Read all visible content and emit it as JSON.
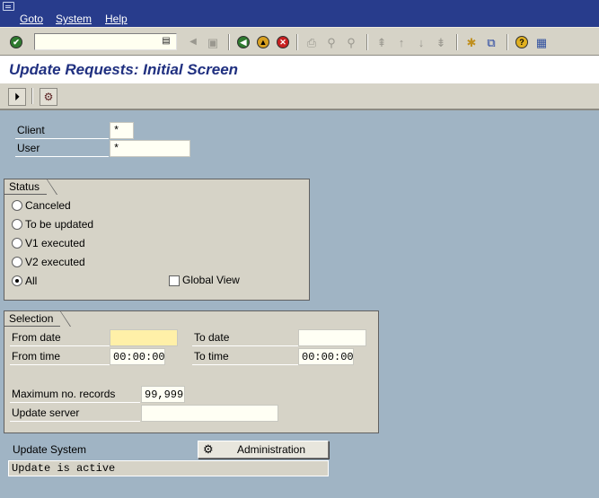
{
  "menu": {
    "items": [
      {
        "label": "Goto"
      },
      {
        "label": "System"
      },
      {
        "label": "Help"
      }
    ]
  },
  "toolbar": {
    "command_value": "",
    "icons": [
      "enter-icon",
      "save-icon",
      "back-icon",
      "exit-icon",
      "cancel-icon",
      "print-icon",
      "find-icon",
      "find-next-icon",
      "first-page-icon",
      "previous-page-icon",
      "next-page-icon",
      "last-page-icon",
      "new-session-icon",
      "shortcut-icon",
      "help-icon",
      "layout-icon"
    ]
  },
  "title": {
    "text": "Update Requests: Initial Screen"
  },
  "app_toolbar": {
    "icons": [
      "execute-icon",
      "administration-icon"
    ]
  },
  "fields": {
    "client_label": "Client",
    "client_value": "*",
    "user_label": "User",
    "user_value": "*"
  },
  "status_group": {
    "title": "Status",
    "options": [
      {
        "label": "Canceled",
        "selected": false
      },
      {
        "label": "To be updated",
        "selected": false
      },
      {
        "label": "V1 executed",
        "selected": false
      },
      {
        "label": "V2 executed",
        "selected": false
      },
      {
        "label": "All",
        "selected": true
      }
    ],
    "global_view_label": "Global View",
    "global_view_checked": false
  },
  "selection_group": {
    "title": "Selection",
    "from_date_label": "From date",
    "from_date_value": "",
    "to_date_label": "To date",
    "to_date_value": "",
    "from_time_label": "From time",
    "from_time_value": "00:00:00",
    "to_time_label": "To time",
    "to_time_value": "00:00:00",
    "max_records_label": "Maximum no. records",
    "max_records_value": "99,999",
    "update_server_label": "Update server",
    "update_server_value": ""
  },
  "update_system": {
    "label": "Update System",
    "button_label": "Administration",
    "status_text": "Update is active"
  },
  "colors": {
    "menubar": "#283c8c",
    "background": "#a0b4c4",
    "panel": "#d6d3c7",
    "title_text": "#203080",
    "required_field": "#fff0a8"
  }
}
